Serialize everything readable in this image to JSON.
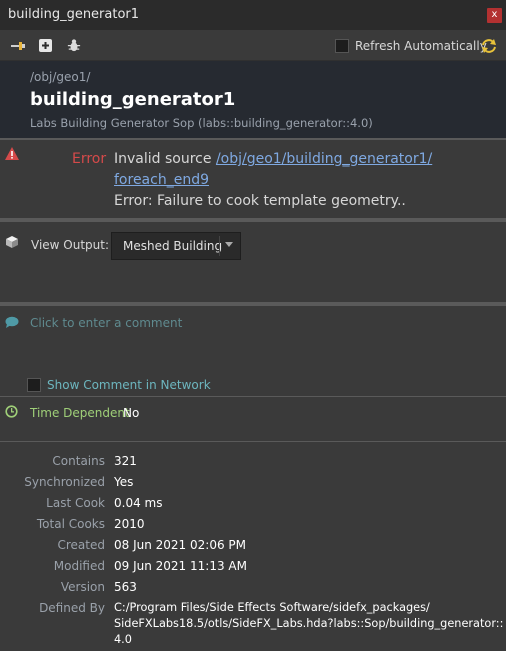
{
  "window": {
    "title": "building_generator1",
    "close_label": "x"
  },
  "toolbar": {
    "icons": [
      "pin-icon",
      "add-icon",
      "bug-icon"
    ],
    "refresh_label": "Refresh Automatically",
    "refresh_checked": false
  },
  "header": {
    "path": "/obj/geo1/",
    "node_name": "building_generator1",
    "node_type": "Labs Building Generator Sop (labs::building_generator::4.0)"
  },
  "error": {
    "label": "Error",
    "prefix": "Invalid source ",
    "link_line1": "/obj/geo1/building_generator1/",
    "link_line2": "foreach_end9",
    "message": "Error: Failure to cook template geometry.."
  },
  "view_output": {
    "label": "View Output:",
    "selected": "Meshed Building"
  },
  "comment": {
    "placeholder": "Click to enter a comment",
    "show_label": "Show Comment in Network",
    "show_checked": false
  },
  "time_dependent": {
    "label": "Time Dependent",
    "value": "No"
  },
  "info": {
    "contains_label": "Contains",
    "contains": "321",
    "synchronized_label": "Synchronized",
    "synchronized": "Yes",
    "last_cook_label": "Last Cook",
    "last_cook": "0.04 ms",
    "total_cooks_label": "Total Cooks",
    "total_cooks": "2010",
    "created_label": "Created",
    "created": "08 Jun 2021 02:06 PM",
    "modified_label": "Modified",
    "modified": "09 Jun 2021 11:13 AM",
    "version_label": "Version",
    "version": "563",
    "defined_by_label": "Defined By",
    "defined_by_1": "C:/Program Files/Side Effects Software/sidefx_packages/",
    "defined_by_2": "SideFXLabs18.5/otls/SideFX_Labs.hda?labs::Sop/building_generator::",
    "defined_by_3": "4.0"
  },
  "colors": {
    "error": "#d54a4a",
    "link": "#7fa9e2",
    "comment_placeholder": "#5f8a8f",
    "time_dependent": "#9fcf78",
    "header_bg": "#262a31"
  }
}
